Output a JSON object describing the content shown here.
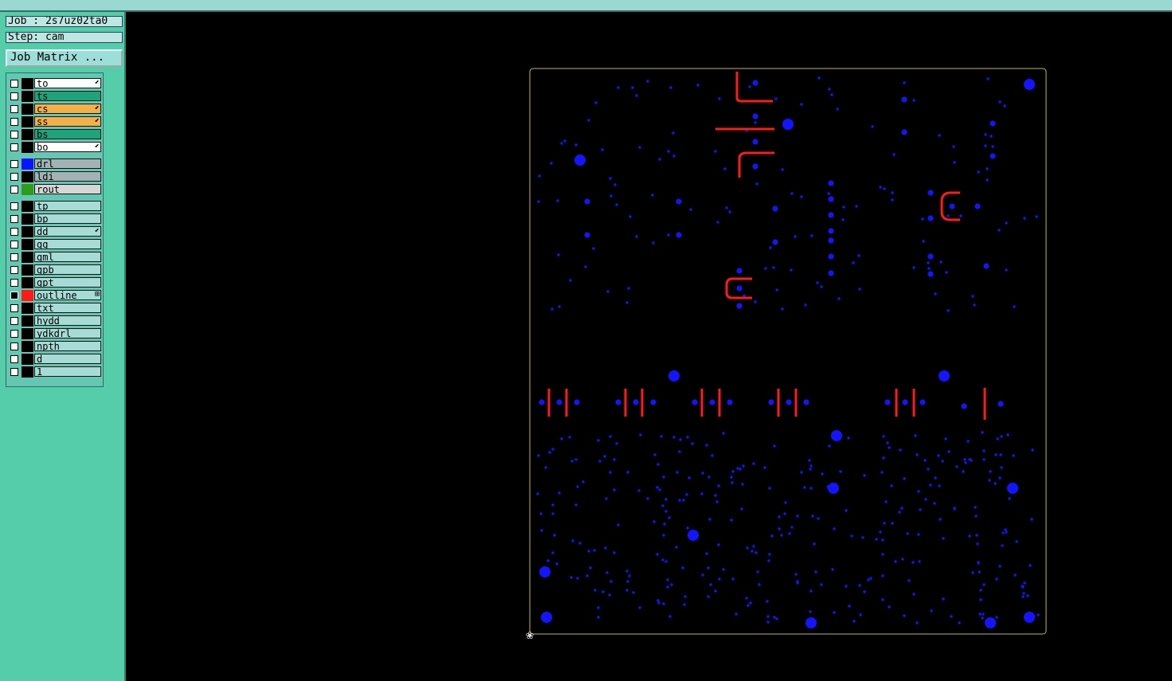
{
  "info": {
    "job": "Job : 2s7uz02ta0",
    "step": "Step: cam"
  },
  "buttons": {
    "job_matrix": "Job Matrix ..."
  },
  "layers": [
    {
      "name": "to",
      "color": "#ffffff",
      "swatch": "#000000",
      "mark": "arrow-icon"
    },
    {
      "name": "ts",
      "color": "#1fa37b",
      "swatch": "#000000",
      "mark": ""
    },
    {
      "name": "cs",
      "color": "#f2b04a",
      "swatch": "#000000",
      "mark": "arrow-icon"
    },
    {
      "name": "ss",
      "color": "#f2b04a",
      "swatch": "#000000",
      "mark": "arrow-icon"
    },
    {
      "name": "bs",
      "color": "#1fa37b",
      "swatch": "#000000",
      "mark": ""
    },
    {
      "name": "bo",
      "color": "#ffffff",
      "swatch": "#000000",
      "mark": "arrow-icon"
    },
    {
      "name": "drl",
      "color": "#a3b2b5",
      "swatch": "#0a14ff",
      "mark": ""
    },
    {
      "name": "ldi",
      "color": "#a3b2b5",
      "swatch": "#000000",
      "mark": ""
    },
    {
      "name": "rout",
      "color": "#d6d6d6",
      "swatch": "#2e9d1c",
      "mark": ""
    },
    {
      "name": "tp",
      "color": "#a6dbd6",
      "swatch": "#000000",
      "mark": ""
    },
    {
      "name": "bp",
      "color": "#a6dbd6",
      "swatch": "#000000",
      "mark": ""
    },
    {
      "name": "dd",
      "color": "#a6dbd6",
      "swatch": "#000000",
      "mark": "arrow-icon"
    },
    {
      "name": "gg",
      "color": "#a6dbd6",
      "swatch": "#000000",
      "mark": ""
    },
    {
      "name": "gml",
      "color": "#a6dbd6",
      "swatch": "#000000",
      "mark": ""
    },
    {
      "name": "gpb",
      "color": "#a6dbd6",
      "swatch": "#000000",
      "mark": ""
    },
    {
      "name": "gpt",
      "color": "#a6dbd6",
      "swatch": "#000000",
      "mark": ""
    },
    {
      "name": "outline",
      "color": "#a6dbd6",
      "swatch": "#ff1a1a",
      "mark": "grid-icon",
      "checked": true
    },
    {
      "name": "txt",
      "color": "#a6dbd6",
      "swatch": "#000000",
      "mark": ""
    },
    {
      "name": "hydd",
      "color": "#a6dbd6",
      "swatch": "#000000",
      "mark": ""
    },
    {
      "name": "ydkdrl",
      "color": "#a6dbd6",
      "swatch": "#000000",
      "mark": ""
    },
    {
      "name": "npth",
      "color": "#a6dbd6",
      "swatch": "#000000",
      "mark": ""
    },
    {
      "name": "d",
      "color": "#a6dbd6",
      "swatch": "#000000",
      "mark": ""
    },
    {
      "name": "1",
      "color": "#a6dbd6",
      "swatch": "#000000",
      "mark": ""
    }
  ],
  "colors": {
    "background": "#000000",
    "drill": "#1414ff",
    "outline": "#ff1a1a",
    "profile": "#c8b44a",
    "sidebar": "#55ccaa"
  },
  "icons": {
    "origin": "origin-crosshair-icon"
  }
}
